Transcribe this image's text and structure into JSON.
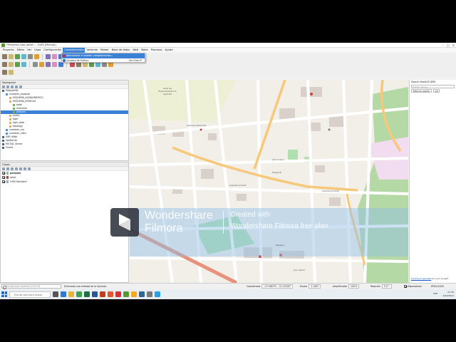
{
  "window": {
    "title": "*Proyecto_tipo_datos — QGIS [Manual]",
    "controls": [
      "–",
      "□",
      "✕"
    ]
  },
  "menu": [
    "Proyecto",
    "Editar",
    "Ver",
    "Capa",
    "Configuración",
    "Complementos",
    "Vectorial",
    "Ráster",
    "Base de datos",
    "Web",
    "Malla",
    "Procesos",
    "Ayuda"
  ],
  "menu_active": "Complementos",
  "dropdown": {
    "items": [
      "Administrar e instalar complementos...",
      "Consola de Python"
    ],
    "shortcut": "Ctrl+Alt+P"
  },
  "browser": {
    "title": "Navegador",
    "items": [
      {
        "label": "PostgreSQL",
        "indent": 0
      },
      {
        "label": "conexion_espacial",
        "indent": 1
      },
      {
        "label": "ESQUEMA_ALFANUMERICO",
        "indent": 2
      },
      {
        "label": "ESQUEMA_ESPACIAL",
        "indent": 2
      },
      {
        "label": "arbol",
        "indent": 3
      },
      {
        "label": "manzana",
        "indent": 3
      },
      {
        "label": "parques",
        "indent": 3,
        "selected": true
      },
      {
        "label": "public",
        "indent": 2
      },
      {
        "label": "tiger",
        "indent": 2
      },
      {
        "label": "tiger_data",
        "indent": 2
      },
      {
        "label": "topology",
        "indent": 2
      },
      {
        "label": "conexion_cxc",
        "indent": 1
      },
      {
        "label": "conexion_vista",
        "indent": 1
      },
      {
        "label": "SAP HANA",
        "indent": 0
      },
      {
        "label": "SpatiaLite",
        "indent": 0
      },
      {
        "label": "MS SQL Server",
        "indent": 0
      },
      {
        "label": "Oracle",
        "indent": 0
      }
    ]
  },
  "layers": {
    "title": "Capas",
    "items": [
      {
        "label": "parques",
        "checked": true,
        "color": "#7bc97b"
      },
      {
        "label": "arbol",
        "checked": true,
        "color": "#c83c3c"
      },
      {
        "label": "OSM Standard",
        "checked": true,
        "color": "#7fb0e0"
      }
    ]
  },
  "map_labels": [
    "Área de Experimentación Agrícola",
    "Avenida Alvaro Ed.",
    "Avenida Ancash",
    "Avenida Ancash",
    "Pasaje B",
    "Pasaje A",
    "Jirón Cusco",
    "Jirón Pasco"
  ],
  "right_panel": {
    "title": "Search NextGIS QMS",
    "search_placeholder": "Search string...",
    "filter_label": "Filter by extent",
    "filter_value": "All",
    "footer_link": "Download geodata",
    "footer_suffix": " for your project"
  },
  "statusbar": {
    "locator_placeholder": "Escriba para localizar (Ctrl+K)",
    "message": "Eliminada una entrada de la leyenda.",
    "coord_label": "Coordenada",
    "coord_value": "-13.36679°, -74.23528°",
    "scale_label": "Escala",
    "scale_value": "1:1967",
    "mag_label": "Amplificador",
    "mag_value": "100%",
    "rot_label": "Rotación",
    "rot_value": "0.0 °",
    "render_label": "Representar",
    "crs": "EPSG:4326"
  },
  "taskbar": {
    "search_placeholder": "Escribe aquí para buscar",
    "lang": "ESP",
    "time": "07:45",
    "date": "6/10/2021"
  },
  "watermark": {
    "brand_line1": "Wondershare",
    "brand_line2": "Filmora",
    "caption_line1": "Created with",
    "caption_line2": "Wondershare Filmora free plan"
  },
  "colors": {
    "selection": "#3b82d6",
    "map_bg": "#f2efe9",
    "park": "#c8e6b0",
    "road_main": "#f7c87a",
    "water_tint": "#8fbfe6",
    "taskbar": "#e9eef3"
  }
}
